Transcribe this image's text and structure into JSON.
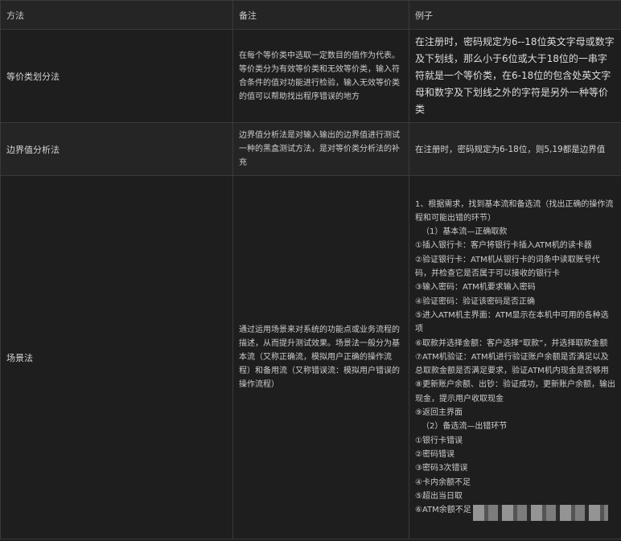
{
  "header": {
    "col1": "方法",
    "col2": "备注",
    "col3": "例子"
  },
  "rows": [
    {
      "method": "等价类划分法",
      "note": "在每个等价类中选取一定数目的值作为代表。等价类分为有效等价类和无效等价类，输入符合条件的值对功能进行检验，输入无效等价类的值可以帮助找出程序错误的地方",
      "example": "在注册时，密码规定为6--18位英文字母或数字及下划线，那么小于6位或大于18位的一串字符就是一个等价类，在6-18位的包含处英文字母和数字及下划线之外的字符是另外一种等价类"
    },
    {
      "method": "边界值分析法",
      "note": "边界值分析法是对输入输出的边界值进行测试一种的黑盒测试方法，是对等价类分析法的补充",
      "example": "在注册时，密码规定为6-18位，则5,19都是边界值"
    },
    {
      "method": "场景法",
      "note": "通过运用场景来对系统的功能点或业务流程的描述，从而提升测试效果。场景法一般分为基本流（又称正确流，模拟用户正确的操作流程）和备用流（又称错误流：模拟用户错误的操作流程）",
      "example_lines": [
        "1、根据需求，找到基本流和备选流（找出正确的操作流程和可能出错的环节）",
        "（1）基本流—正确取款",
        "①插入银行卡：客户将银行卡插入ATM机的读卡器",
        "②验证银行卡：ATM机从银行卡的词条中读取账号代码，并检查它是否属于可以接收的银行卡",
        "③输入密码：ATM机要求输入密码",
        "④验证密码：验证该密码是否正确",
        "⑤进入ATM机主界面：ATM显示在本机中可用的各种选项",
        "⑥取款并选择金额：客户选择“取款”，并选择取款金额",
        "⑦ATM机验证：ATM机进行验证账户余额是否满足以及总取款金额是否满足要求，验证ATM机内现金是否够用",
        "⑧更新账户余额、出钞：验证成功，更新账户余额，输出现金，提示用户收取现金",
        "⑨返回主界面",
        "（2）备选流—出错环节",
        "①银行卡错误",
        "②密码错误",
        "③密码3次错误",
        "④卡内余额不足",
        "⑤超出当日取",
        "⑥ATM余额不足"
      ]
    }
  ]
}
